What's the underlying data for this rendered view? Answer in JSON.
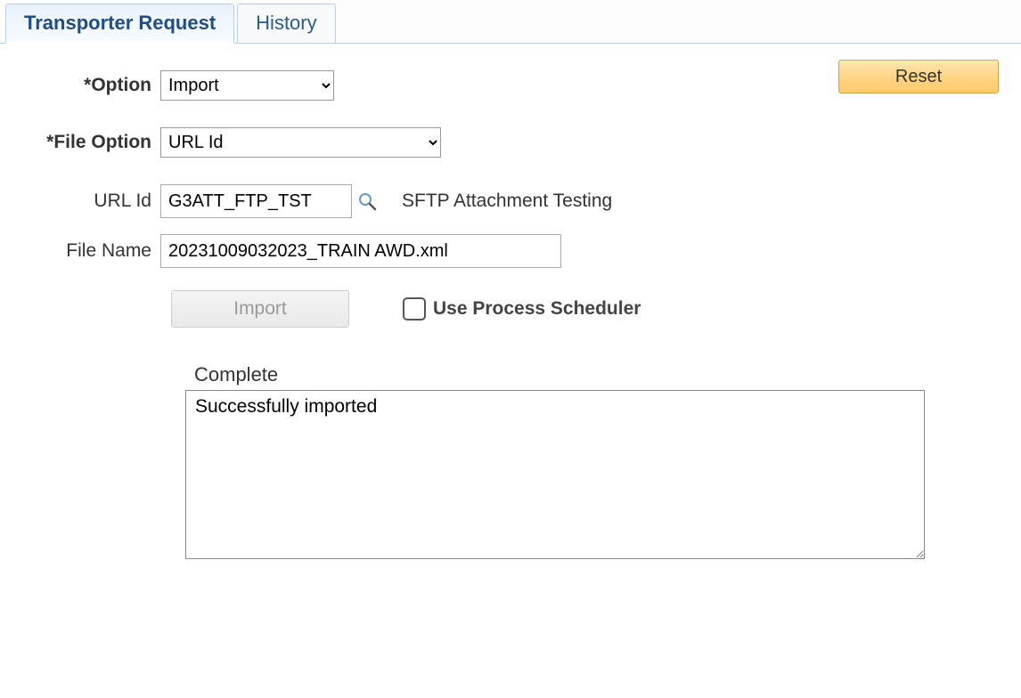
{
  "tabs": {
    "transporter": "Transporter Request",
    "history": "History"
  },
  "buttons": {
    "reset": "Reset",
    "import": "Import"
  },
  "labels": {
    "option": "*Option",
    "file_option": "*File Option",
    "url_id": "URL Id",
    "file_name": "File Name",
    "use_scheduler": "Use Process Scheduler",
    "status": "Complete"
  },
  "values": {
    "option": "Import",
    "file_option": "URL Id",
    "url_id": "G3ATT_FTP_TST",
    "url_desc": "SFTP Attachment Testing",
    "file_name": "20231009032023_TRAIN AWD.xml",
    "status_text": "Successfully imported"
  }
}
